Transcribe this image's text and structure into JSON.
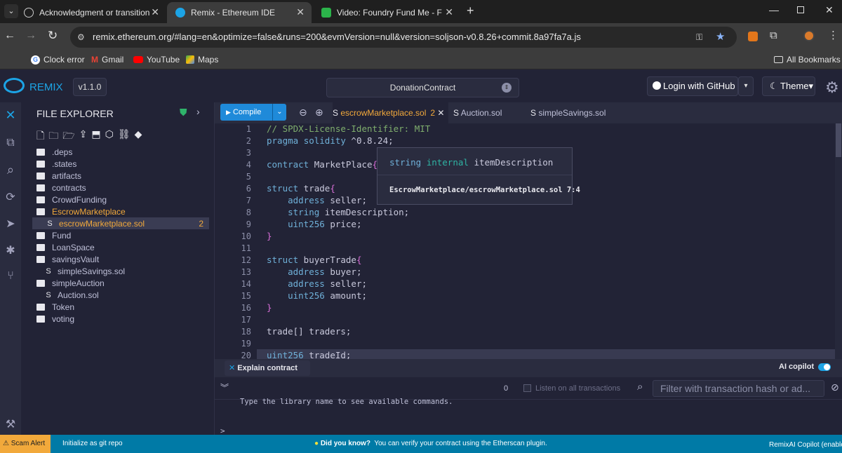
{
  "browser": {
    "tabs": [
      {
        "title": "Acknowledgment or transition",
        "active": false
      },
      {
        "title": "Remix - Ethereum IDE",
        "active": true
      },
      {
        "title": "Video: Foundry Fund Me - Foun",
        "active": false
      }
    ],
    "url": "remix.ethereum.org/#lang=en&optimize=false&runs=200&evmVersion=null&version=soljson-v0.8.26+commit.8a97fa7a.js",
    "bookmarks": [
      "Clock error",
      "Gmail",
      "YouTube",
      "Maps"
    ],
    "all_bookmarks": "All Bookmarks"
  },
  "remix": {
    "logo": "REMIX",
    "version": "v1.1.0",
    "workspace": "DonationContract",
    "login": "Login with GitHub",
    "theme": "Theme",
    "accent": "#1ca4e6"
  },
  "explorer": {
    "title": "FILE EXPLORER",
    "items": [
      {
        "label": ".deps",
        "type": "folder",
        "indent": 0
      },
      {
        "label": ".states",
        "type": "folder",
        "indent": 0
      },
      {
        "label": "artifacts",
        "type": "folder",
        "indent": 0
      },
      {
        "label": "contracts",
        "type": "folder",
        "indent": 0
      },
      {
        "label": "CrowdFunding",
        "type": "folder",
        "indent": 0
      },
      {
        "label": "EscrowMarketplace",
        "type": "folder",
        "indent": 0,
        "open": true
      },
      {
        "label": "escrowMarketplace.sol",
        "type": "file",
        "indent": 1,
        "selected": true,
        "badge": "2"
      },
      {
        "label": "Fund",
        "type": "folder",
        "indent": 0
      },
      {
        "label": "LoanSpace",
        "type": "folder",
        "indent": 0
      },
      {
        "label": "savingsVault",
        "type": "folder",
        "indent": 0
      },
      {
        "label": "simpleSavings.sol",
        "type": "file",
        "indent": 1
      },
      {
        "label": "simpleAuction",
        "type": "folder",
        "indent": 0
      },
      {
        "label": "Auction.sol",
        "type": "file",
        "indent": 1
      },
      {
        "label": "Token",
        "type": "folder",
        "indent": 0
      },
      {
        "label": "voting",
        "type": "folder",
        "indent": 0
      }
    ]
  },
  "editor": {
    "compile": "Compile",
    "tabs": [
      {
        "label": "escrowMarketplace.sol",
        "badge": "2",
        "active": true
      },
      {
        "label": "Auction.sol",
        "active": false
      },
      {
        "label": "simpleSavings.sol",
        "active": false
      }
    ],
    "line_numbers": [
      "1",
      "2",
      "3",
      "4",
      "5",
      "6",
      "7",
      "8",
      "9",
      "10",
      "11",
      "12",
      "13",
      "14",
      "15",
      "16",
      "17",
      "18",
      "19",
      "20"
    ],
    "hover": {
      "signature_type": "string",
      "signature_kw": "internal",
      "signature_name": "itemDescription",
      "location": "EscrowMarketplace/escrowMarketplace.sol 7:4"
    }
  },
  "terminal": {
    "explain": "Explain contract",
    "ai_copilot": "AI copilot",
    "count": "0",
    "listen": "Listen on all transactions",
    "filter_placeholder": "Filter with transaction hash or ad...",
    "hint": "Type the library name to see available commands.",
    "prompt": ">"
  },
  "status": {
    "scam_alert": "Scam Alert",
    "git": "Initialize as git repo",
    "did_you_know": "Did you know?",
    "tip": "You can verify your contract using the Etherscan plugin.",
    "copilot": "RemixAI Copilot (enabled)"
  }
}
